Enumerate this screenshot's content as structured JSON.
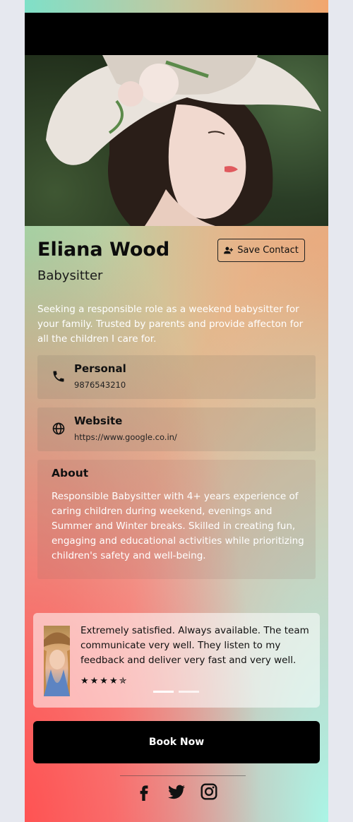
{
  "profile": {
    "name": "Eliana Wood",
    "role": "Babysitter",
    "bio": "Seeking a responsible role as a weekend babysitter for your family. Trusted by parents and provide affecton for all the children I care for.",
    "save_label": "Save Contact"
  },
  "contacts": [
    {
      "label": "Personal",
      "value": "9876543210",
      "icon": "phone-icon"
    },
    {
      "label": "Website",
      "value": "https://www.google.co.in/",
      "icon": "globe-icon"
    }
  ],
  "about": {
    "label": "About",
    "text": "Responsible Babysitter with 4+ years experience of caring children during weekend, evenings and Summer and Winter breaks. Skilled in creating fun, engaging and educational activities while prioritizing children's safety and well-being."
  },
  "testimonial": {
    "quote": "Extremely satisfied. Always available. The team communicate very well. They listen to my feedback and deliver very fast and very well.",
    "rating": 4.5,
    "stars": "★★★★✯"
  },
  "book_label": "Book Now",
  "social": [
    "facebook-icon",
    "twitter-icon",
    "instagram-icon"
  ],
  "colors": {
    "top_bar_start": "#7fe0c8",
    "top_bar_end": "#f2a66e",
    "button": "#000000",
    "accent_coral": "#ff5a5a",
    "accent_mint": "#aaf5e6"
  }
}
